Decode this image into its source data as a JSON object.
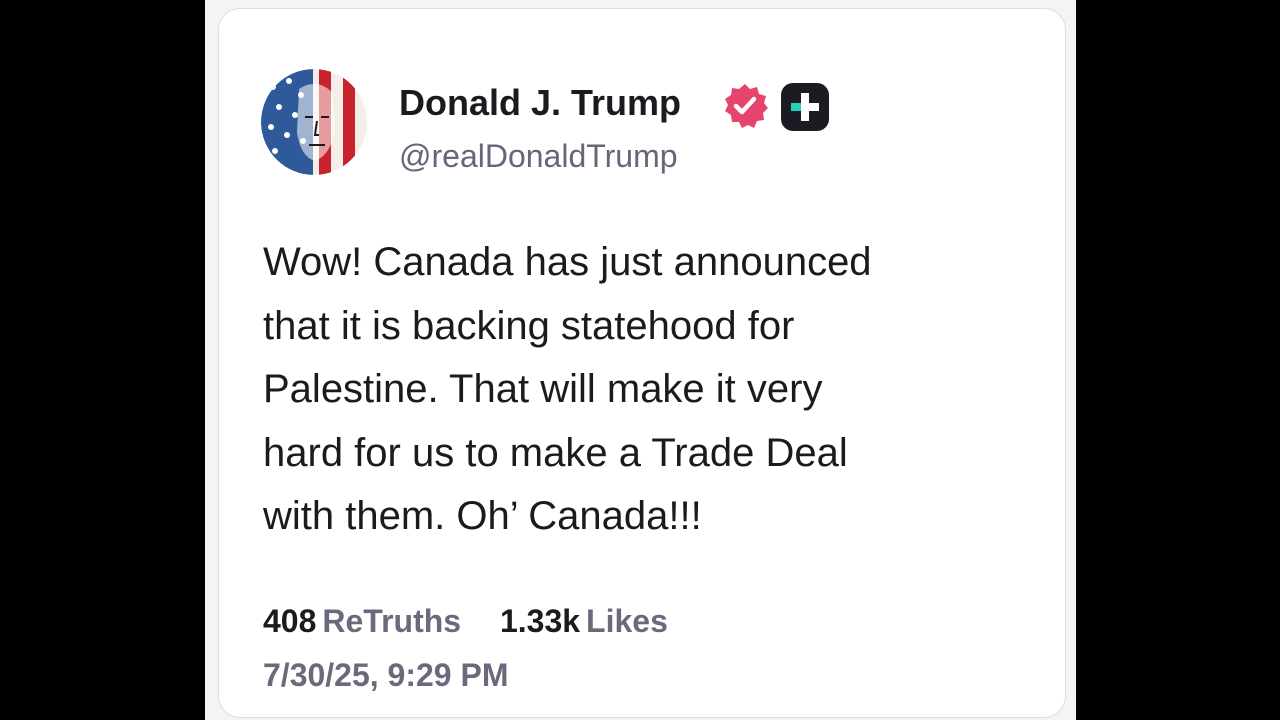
{
  "colors": {
    "background": "#000000",
    "card": "#ffffff",
    "text_primary": "#1b1b1f",
    "text_secondary": "#6a6a7c",
    "verified_badge": "#e6436d",
    "plus_badge": "#1b1b24",
    "plus_accent": "#27d3b8"
  },
  "author": {
    "avatar_icon": "flag-portrait-avatar",
    "display_name": "Donald J. Trump",
    "verified_icon": "verified-badge-icon",
    "plus_icon": "plus-badge-icon",
    "handle": "@realDonaldTrump"
  },
  "post": {
    "lines": [
      "Wow! Canada has just announced",
      "that it is backing statehood for",
      "Palestine. That will make it very",
      "hard for us to make a Trade Deal",
      "with them. Oh’ Canada!!!"
    ]
  },
  "stats": {
    "retruths_count": "408",
    "retruths_label": "ReTruths",
    "likes_count": "1.33k",
    "likes_label": "Likes"
  },
  "timestamp": "7/30/25, 9:29 PM"
}
